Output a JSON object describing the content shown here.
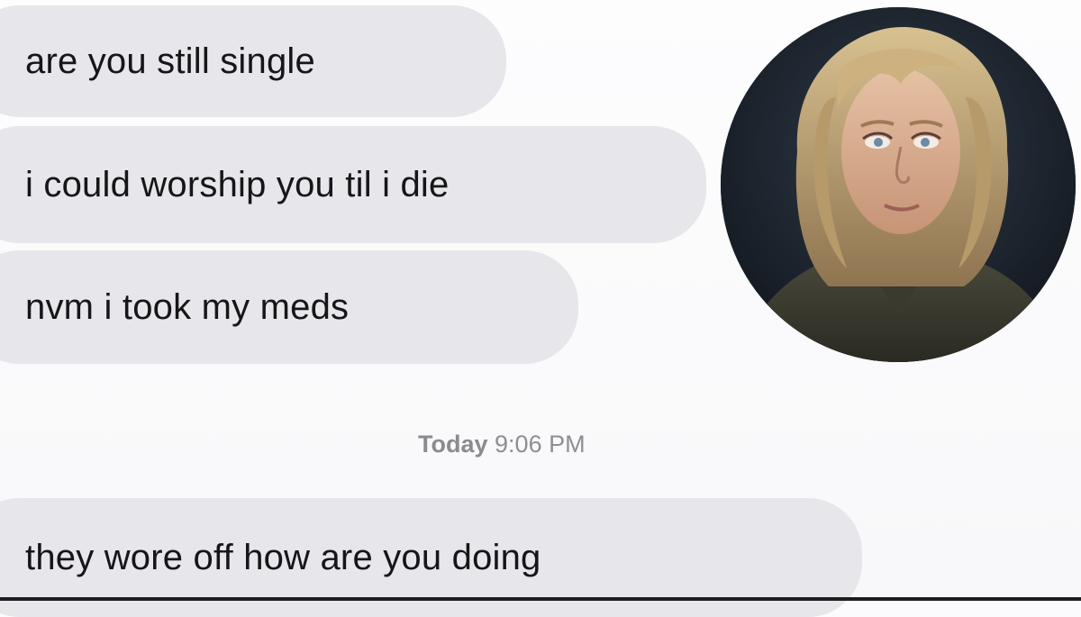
{
  "conversation": {
    "messages": [
      {
        "text": "are you still single"
      },
      {
        "text": "i could worship you til i die"
      },
      {
        "text": "nvm i took my meds"
      },
      {
        "text": "they wore off how are you doing"
      }
    ],
    "timestamp": {
      "day": "Today",
      "time": "9:06 PM"
    }
  },
  "avatar": {
    "icon": "person-portrait-avatar"
  },
  "colors": {
    "background": "#fbfbfd",
    "bubble": "#e6e6eb",
    "text": "#161618",
    "timestamp": "#8e8e93"
  }
}
